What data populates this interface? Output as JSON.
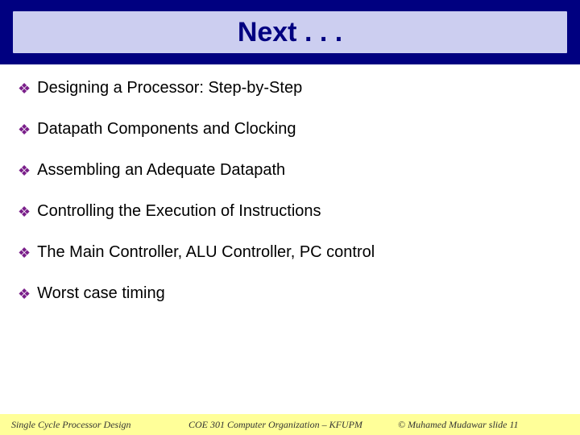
{
  "title": "Next . . .",
  "bullets": [
    "Designing a Processor: Step-by-Step",
    "Datapath Components and Clocking",
    "Assembling an Adequate Datapath",
    "Controlling the Execution of Instructions",
    "The Main Controller, ALU Controller, PC control",
    "Worst case timing"
  ],
  "footer": {
    "left": "Single Cycle Processor Design",
    "center": "COE 301 Computer Organization – KFUPM",
    "right": "© Muhamed Mudawar  slide 11"
  }
}
